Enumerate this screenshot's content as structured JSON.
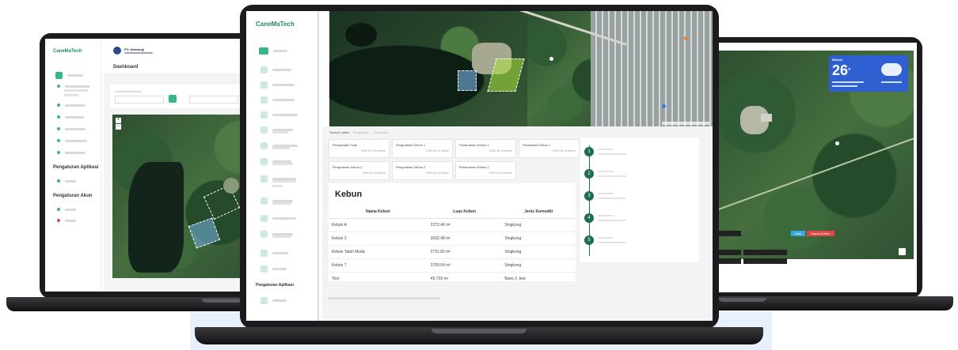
{
  "brand": {
    "name": "CaneMaTech"
  },
  "left_screen": {
    "brand": "CaneMaTech",
    "user_name": "PG Jatiwangi",
    "page_title": "Dashboard",
    "sections": [
      "Pengaturan Aplikasi",
      "Pengaturan Akun"
    ]
  },
  "center_screen": {
    "brand": "CaneMaTech",
    "tabs": [
      "Sensus Lahan",
      "Bongkaran",
      "Keprasan"
    ],
    "cards": [
      {
        "title": "Persyaratan Total",
        "value": "1000 Ha / 89 Kebun"
      },
      {
        "title": "Pengolahan Kebun 1",
        "value": "1000 Ha / 8 Kebun"
      },
      {
        "title": "Penanaman Kebun 1",
        "value": "1000 Ha / 8 Kebun"
      },
      {
        "title": "Perawatan Kebun 1",
        "value": "1000 Ha / 8 Kebun"
      },
      {
        "title": "Pengolahan Kebun 2",
        "value": "1000 Ha / 8 Kebun"
      },
      {
        "title": "Pengolahan Kebun 2",
        "value": "1000 Ha / 8 Kebun"
      },
      {
        "title": "Penanaman Kebun 2",
        "value": "1000 Ha / 8 Kebun"
      }
    ],
    "table": {
      "title": "Kebun",
      "headers": [
        "Nama Kebun",
        "Luas Kebun",
        "Jenis Komoditi"
      ],
      "rows": [
        [
          "Kebun A",
          "2272.46 m²",
          "Singkong"
        ],
        [
          "Kebun 2",
          "3032.48 m²",
          "Singkong"
        ],
        [
          "Kebun Talah Muda",
          "2721.82 m²",
          "Singkong"
        ],
        [
          "Kebun 7",
          "3769.04 m²",
          "Singkong"
        ],
        [
          "Test",
          "45,729 m²",
          "Baris 3 ,test"
        ]
      ]
    },
    "timeline": [
      "1",
      "2",
      "3",
      "4",
      "5"
    ],
    "sidebar_section": "Pengaturan Aplikasi"
  },
  "right_screen": {
    "weather": {
      "city": "Bekasi",
      "temp": "26",
      "unit": "°"
    },
    "buttons": [
      "Ubah",
      "Hapus Kebun"
    ]
  },
  "colors": {
    "accent": "#37b58c",
    "brand_green": "#1f8a6a",
    "timeline_dot": "#1f6b52",
    "weather_blue": "#2f5fd0",
    "danger": "#e04646",
    "info": "#35a8e0",
    "laptop": "#1b1b1d"
  }
}
